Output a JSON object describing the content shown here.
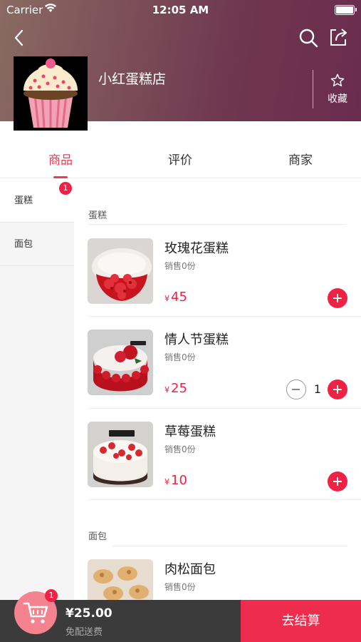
{
  "status_bar": {
    "carrier": "Carrier",
    "time": "12:05 AM"
  },
  "shop": {
    "name": "小红蛋糕店",
    "favorite_label": "收藏"
  },
  "tabs": [
    {
      "label": "商品",
      "active": true
    },
    {
      "label": "评价",
      "active": false
    },
    {
      "label": "商家",
      "active": false
    }
  ],
  "categories": [
    {
      "label": "蛋糕",
      "badge": "1",
      "active": true
    },
    {
      "label": "面包",
      "badge": "",
      "active": false
    }
  ],
  "sections": [
    {
      "title": "蛋糕",
      "items": [
        {
          "name": "玫瑰花蛋糕",
          "sales": "销售0份",
          "currency": "¥",
          "price": "45",
          "quantity": ""
        },
        {
          "name": "情人节蛋糕",
          "sales": "销售0份",
          "currency": "¥",
          "price": "25",
          "quantity": "1"
        },
        {
          "name": "草莓蛋糕",
          "sales": "销售0份",
          "currency": "¥",
          "price": "10",
          "quantity": ""
        }
      ]
    },
    {
      "title": "面包",
      "items": [
        {
          "name": "肉松面包",
          "sales": "销售0份"
        }
      ]
    }
  ],
  "cart": {
    "badge": "1",
    "total": "¥25.00",
    "delivery_note": "免配送费",
    "checkout_label": "去结算"
  },
  "colors": {
    "accent": "#ee2244",
    "header_start": "#8a6a62",
    "header_end": "#6a2c4d",
    "cart_bar": "#3b3b3b"
  }
}
